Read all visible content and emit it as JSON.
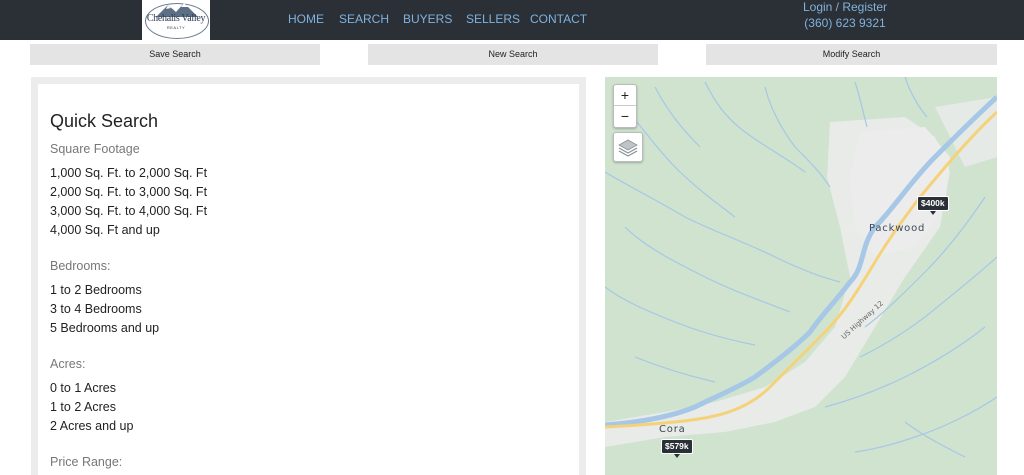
{
  "header": {
    "logo": {
      "name": "Chehalis Valley",
      "sub": "REALTY"
    },
    "nav": [
      {
        "label": "HOME"
      },
      {
        "label": "SEARCH"
      },
      {
        "label": "BUYERS"
      },
      {
        "label": "SELLERS"
      },
      {
        "label": "CONTACT"
      }
    ],
    "account": {
      "login": "Login / Register",
      "phone": "(360) 623 9321"
    }
  },
  "actions": {
    "save": "Save Search",
    "new": "New Search",
    "modify": "Modify Search"
  },
  "quick_search": {
    "title": "Quick Search",
    "square_footage": {
      "heading": "Square Footage",
      "options": [
        "1,000 Sq. Ft. to 2,000 Sq. Ft",
        "2,000 Sq. Ft. to 3,000 Sq. Ft",
        "3,000 Sq. Ft. to 4,000 Sq. Ft",
        "4,000 Sq. Ft and up"
      ]
    },
    "bedrooms": {
      "heading": "Bedrooms:",
      "options": [
        "1 to 2 Bedrooms",
        "3 to 4 Bedrooms",
        "5 Bedrooms and up"
      ]
    },
    "acres": {
      "heading": "Acres:",
      "options": [
        "0 to 1 Acres",
        "1 to 2 Acres",
        "2 Acres and up"
      ]
    },
    "price_range": {
      "heading": "Price Range:"
    }
  },
  "map": {
    "zoom_in": "+",
    "zoom_out": "−",
    "places": {
      "packwood": "Packwood",
      "cora": "Cora"
    },
    "highway": "US Highway 12",
    "markers": [
      {
        "price": "$400k"
      },
      {
        "price": "$579k"
      }
    ],
    "colors": {
      "forest": "#cfe3cf",
      "urban": "#ececec",
      "river": "#a7c7e7",
      "road": "#f5d27a"
    }
  }
}
